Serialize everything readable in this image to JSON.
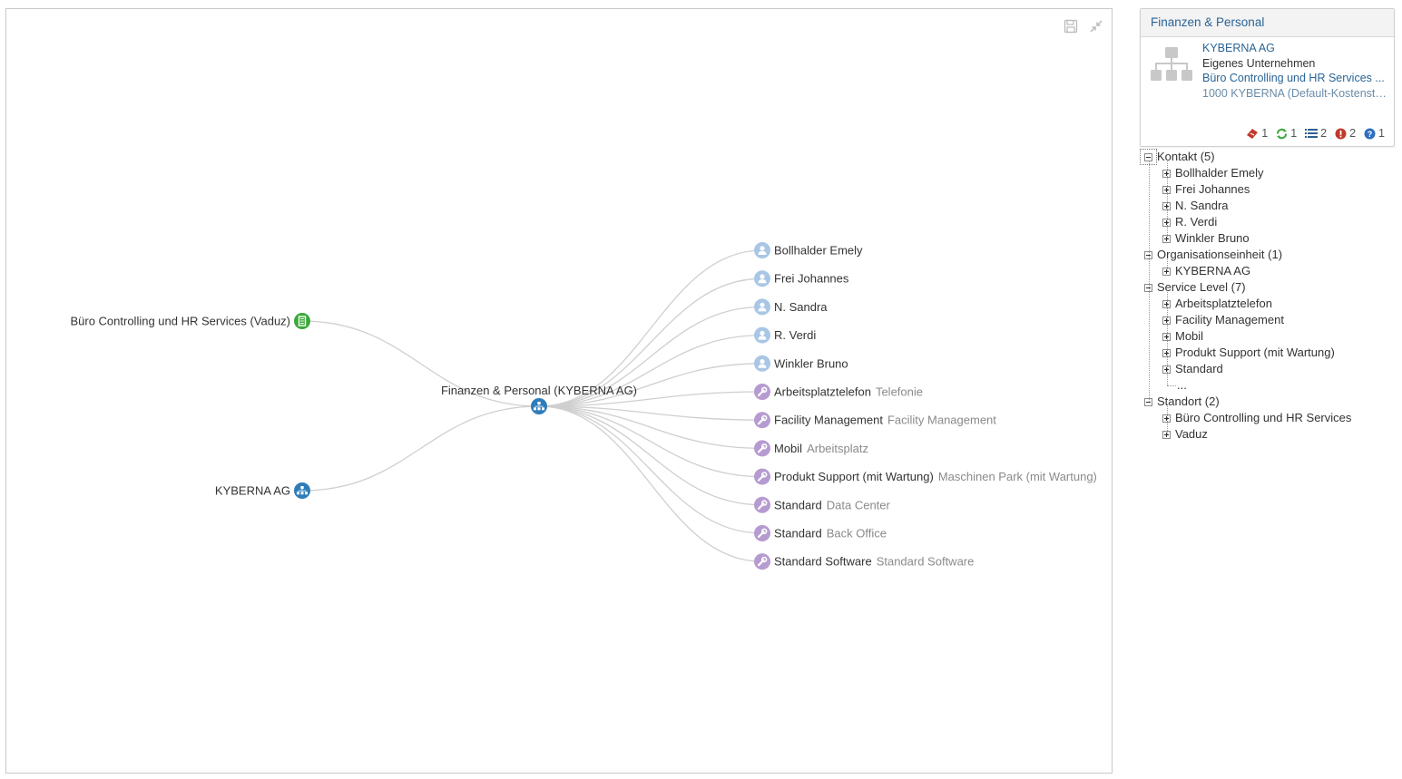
{
  "graph": {
    "center": {
      "label": "Finanzen & Personal (KYBERNA AG)",
      "icon": "org-chart-icon",
      "color": "#2f7cb8"
    },
    "left_nodes": [
      {
        "label": "Büro Controlling und HR Services (Vaduz)",
        "icon": "building-icon",
        "color": "#3aa83a"
      },
      {
        "label": "KYBERNA AG",
        "icon": "org-chart-icon",
        "color": "#2f7cb8"
      }
    ],
    "right_nodes": [
      {
        "label": "Bollhalder Emely",
        "sub": "",
        "icon": "person-icon",
        "color": "#a9c6e5"
      },
      {
        "label": "Frei Johannes",
        "sub": "",
        "icon": "person-icon",
        "color": "#a9c6e5"
      },
      {
        "label": "N. Sandra",
        "sub": "",
        "icon": "person-icon",
        "color": "#a9c6e5"
      },
      {
        "label": "R. Verdi",
        "sub": "",
        "icon": "person-icon",
        "color": "#a9c6e5"
      },
      {
        "label": "Winkler Bruno",
        "sub": "",
        "icon": "person-icon",
        "color": "#a9c6e5"
      },
      {
        "label": "Arbeitsplatztelefon",
        "sub": "Telefonie",
        "icon": "wrench-icon",
        "color": "#b69bd0"
      },
      {
        "label": "Facility Management",
        "sub": "Facility Management",
        "icon": "wrench-icon",
        "color": "#b69bd0"
      },
      {
        "label": "Mobil",
        "sub": "Arbeitsplatz",
        "icon": "wrench-icon",
        "color": "#b69bd0"
      },
      {
        "label": "Produkt Support (mit Wartung)",
        "sub": "Maschinen Park (mit Wartung)",
        "icon": "wrench-icon",
        "color": "#b69bd0"
      },
      {
        "label": "Standard",
        "sub": "Data Center",
        "icon": "wrench-icon",
        "color": "#b69bd0"
      },
      {
        "label": "Standard",
        "sub": "Back Office",
        "icon": "wrench-icon",
        "color": "#b69bd0"
      },
      {
        "label": "Standard Software",
        "sub": "Standard Software",
        "icon": "wrench-icon",
        "color": "#b69bd0"
      }
    ],
    "toolbar": {
      "save_icon": "save-icon",
      "collapse_icon": "collapse-icon"
    }
  },
  "card": {
    "title": "Finanzen & Personal",
    "icon": "org-chart-icon",
    "company": "KYBERNA AG",
    "type": "Eigenes Unternehmen",
    "location": "Büro Controlling und HR Services ...",
    "cost_center": "1000 KYBERNA (Default-Kostenste...",
    "badges": [
      {
        "icon": "ticket-icon",
        "count": "1",
        "color": "#c0392b"
      },
      {
        "icon": "refresh-icon",
        "count": "1",
        "color": "#3aa83a"
      },
      {
        "icon": "list-icon",
        "count": "2",
        "color": "#2f5f8f"
      },
      {
        "icon": "alert-icon",
        "count": "2",
        "color": "#c0392b"
      },
      {
        "icon": "help-icon",
        "count": "1",
        "color": "#2f6fc0"
      }
    ]
  },
  "tree": {
    "groups": [
      {
        "label": "Kontakt (5)",
        "children": [
          "Bollhalder Emely",
          "Frei Johannes",
          "N. Sandra",
          "R. Verdi",
          "Winkler Bruno"
        ]
      },
      {
        "label": "Organisationseinheit (1)",
        "children": [
          "KYBERNA AG"
        ]
      },
      {
        "label": "Service Level (7)",
        "children": [
          "Arbeitsplatztelefon",
          "Facility Management",
          "Mobil",
          "Produkt Support (mit Wartung)",
          "Standard"
        ],
        "more": "..."
      },
      {
        "label": "Standort (2)",
        "children": [
          "Büro Controlling und HR Services",
          "Vaduz"
        ]
      }
    ]
  }
}
